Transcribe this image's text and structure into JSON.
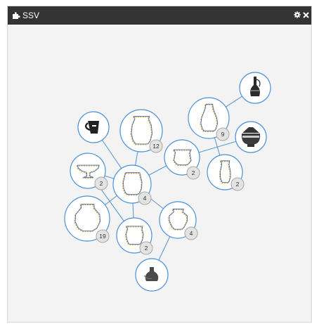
{
  "window": {
    "title": "SSV",
    "title_icon": "puzzle-icon",
    "controls": [
      "gear-icon",
      "close-icon"
    ]
  },
  "colors": {
    "titlebar": "#333333",
    "canvas": "#f3f3f3",
    "edge": "#5b9bd5",
    "ring": "#4a90d9",
    "badge_fill": "#e3e3e3",
    "badge_stroke": "#a8a8a8"
  },
  "graph": {
    "nodes": [
      {
        "id": "jug-photo",
        "kind": "photo",
        "icon": "jug-icon"
      },
      {
        "id": "tall-jar",
        "kind": "profile",
        "icon": "tall-vase-icon",
        "count": "12"
      },
      {
        "id": "slim-oinochoe",
        "kind": "photo",
        "icon": "oinochoe-icon"
      },
      {
        "id": "lidded-krater",
        "kind": "photo",
        "icon": "lidded-krater-icon"
      },
      {
        "id": "ovoid-vase",
        "kind": "profile",
        "icon": "ovoid-vase-icon",
        "count": "9"
      },
      {
        "id": "bell-krater",
        "kind": "profile",
        "icon": "bell-krater-icon",
        "count": "2"
      },
      {
        "id": "kylix",
        "kind": "profile",
        "icon": "kylix-icon",
        "count": "2"
      },
      {
        "id": "central-jar",
        "kind": "profile",
        "icon": "jar-icon",
        "count": "4"
      },
      {
        "id": "narrow-vase",
        "kind": "profile",
        "icon": "narrow-vase-icon",
        "count": "2"
      },
      {
        "id": "round-amphora",
        "kind": "profile",
        "icon": "round-amphora-icon",
        "count": "19"
      },
      {
        "id": "small-jar",
        "kind": "profile",
        "icon": "small-jar-icon",
        "count": "2"
      },
      {
        "id": "hydria",
        "kind": "profile",
        "icon": "hydria-icon",
        "count": "4"
      },
      {
        "id": "black-jar",
        "kind": "photo",
        "icon": "black-jar-icon"
      }
    ]
  }
}
